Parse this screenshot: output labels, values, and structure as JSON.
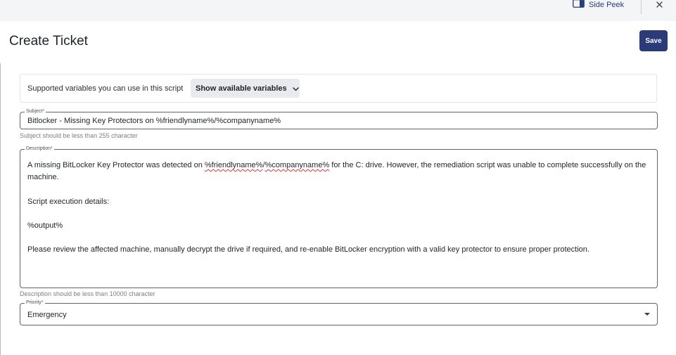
{
  "topbar": {
    "side_peek_label": "Side Peek",
    "side_peek_icon": "side-panel-icon",
    "close_icon": "close-icon"
  },
  "page": {
    "title": "Create Ticket",
    "save_label": "Save",
    "accent_color": "#2b3a78"
  },
  "variables": {
    "text": "Supported variables you can use in this script",
    "button_label": "Show available variables",
    "button_icon": "chevron-down-icon"
  },
  "subject": {
    "label": "Subject",
    "required_mark": "*",
    "value": "Bitlocker - Missing Key Protectors on %friendlyname%/%companyname%",
    "hint": "Subject should be less than 255 character"
  },
  "description": {
    "label": "Description",
    "required_mark": "*",
    "para1_before": "A missing BitLocker Key Protector was detected on ",
    "para1_var1": "%friendlyname%",
    "para1_sep": "/",
    "para1_var2": "%companyname%",
    "para1_after": " for the C: drive. However, the remediation script was unable to complete successfully on the machine.",
    "para2": "Script execution details:",
    "para3": "%output%",
    "para4": "Please review the affected machine, manually decrypt the drive if required, and re-enable BitLocker encryption with a valid key protector to ensure proper protection.",
    "hint": "Description should be less than 10000 character"
  },
  "priority": {
    "label": "Priority",
    "required_mark": "*",
    "value": "Emergency",
    "icon": "dropdown-caret-icon"
  }
}
